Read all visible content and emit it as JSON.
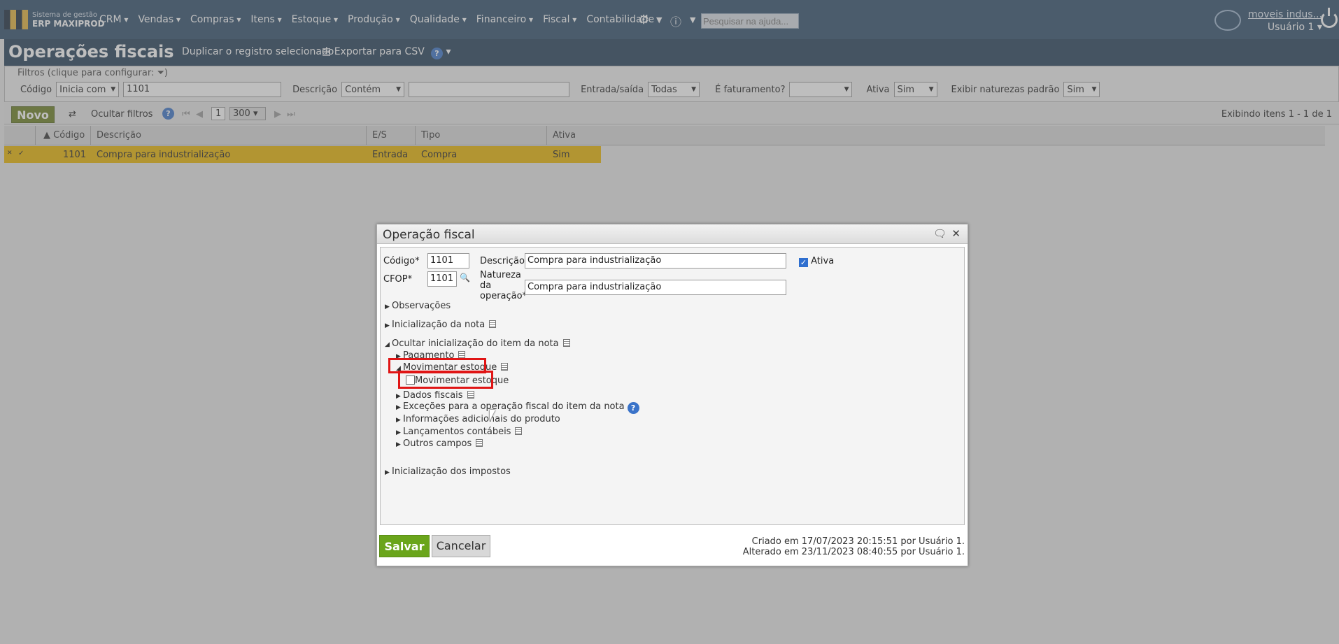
{
  "app": {
    "logo_line1": "Sistema de gestão",
    "logo_line2": "ERP MAXIPROD",
    "menu": [
      "CRM",
      "Vendas",
      "Compras",
      "Itens",
      "Estoque",
      "Produção",
      "Qualidade",
      "Financeiro",
      "Fiscal",
      "Contabilidade"
    ],
    "search_placeholder": "Pesquisar na ajuda...",
    "company": "moveis indus...",
    "user": "Usuário 1"
  },
  "page": {
    "title": "Operações fiscais",
    "duplicate": "Duplicar o registro selecionado",
    "export": "Exportar para CSV"
  },
  "filters": {
    "legend": "Filtros (clique para configurar:",
    "codigo_label": "Código",
    "codigo_mode": "Inicia com",
    "codigo_value": "1101",
    "descricao_label": "Descrição",
    "descricao_mode": "Contém",
    "descricao_value": "",
    "es_label": "Entrada/saída",
    "es_value": "Todas",
    "faturamento_label": "É faturamento?",
    "faturamento_value": "",
    "ativa_label": "Ativa",
    "ativa_value": "Sim",
    "naturezas_label": "Exibir naturezas padrão",
    "naturezas_value": "Sim"
  },
  "toolbar": {
    "novo": "Novo",
    "hide_filters": "Ocultar filtros",
    "page": "1",
    "page_size": "300",
    "showing": "Exibindo itens 1 - 1 de 1"
  },
  "grid": {
    "headers": [
      "Código",
      "Descrição",
      "E/S",
      "Tipo",
      "Ativa"
    ],
    "rows": [
      {
        "codigo": "1101",
        "descricao": "Compra para industrialização",
        "es": "Entrada",
        "tipo": "Compra",
        "ativa": "Sim"
      }
    ]
  },
  "modal": {
    "title": "Operação fiscal",
    "codigo_label": "Código*",
    "codigo_value": "1101",
    "descricao_label": "Descrição*",
    "descricao_value": "Compra para industrialização",
    "ativa_label": "Ativa",
    "cfop_label": "CFOP*",
    "cfop_value": "1101",
    "natureza_label_1": "Natureza",
    "natureza_label_2": "da",
    "natureza_label_3": "operação*",
    "natureza_value": "Compra para industrialização",
    "sections": {
      "observacoes": "Observações",
      "inicializacao_nota": "Inicialização da nota",
      "ocultar_item": "Ocultar inicialização do item da nota",
      "pagamento": "Pagamento",
      "movimentar_estoque": "Movimentar estoque",
      "movimentar_estoque_check": "Movimentar estoque",
      "dados_fiscais": "Dados fiscais",
      "excecoes": "Exceções para a operação fiscal do item da nota",
      "info_adicionais": "Informações adicionais do produto",
      "lancamentos": "Lançamentos contábeis",
      "outros": "Outros campos",
      "impostos": "Inicialização dos impostos"
    },
    "salvar": "Salvar",
    "cancelar": "Cancelar",
    "criado": "Criado em 17/07/2023 20:15:51 por Usuário 1.",
    "alterado": "Alterado em 23/11/2023 08:40:55 por Usuário 1."
  }
}
